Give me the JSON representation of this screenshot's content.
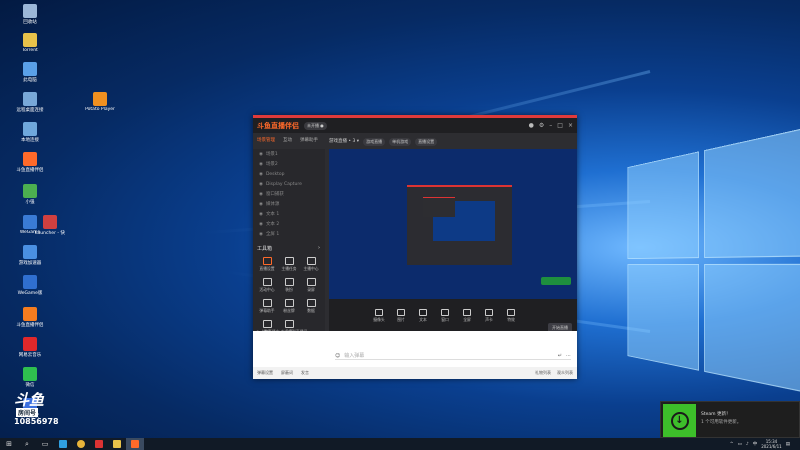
{
  "desktop": {
    "icons": [
      {
        "label": "回收站",
        "color": "#9bb7d8"
      },
      {
        "label": "Torrent",
        "color": "#e8c24a"
      },
      {
        "label": "此电脑",
        "color": "#5aa0e8"
      },
      {
        "label": "远程桌面连接",
        "color": "#78a8d8"
      },
      {
        "label": "本地连接",
        "color": "#6fa8dc"
      },
      {
        "label": "斗鱼直播伴侣",
        "color": "#ff6a2a"
      },
      {
        "label": "小强",
        "color": "#4caf50"
      },
      {
        "label": "WeGame",
        "color": "#3a7bd5"
      },
      {
        "label": "游戏加速器",
        "color": "#4a90e2"
      },
      {
        "label": "WeGame版",
        "color": "#2f6fd0"
      },
      {
        "label": "斗鱼直播伴侣",
        "color": "#f57c1f"
      },
      {
        "label": "网易云音乐",
        "color": "#e0282b"
      },
      {
        "label": "微信",
        "color": "#2fbf4f"
      },
      {
        "label": "腾讯会议",
        "color": "#3a6fe0"
      },
      {
        "label": "Potato Player",
        "color": "#f09020"
      },
      {
        "label": "Launcher - 快捷方式",
        "color": "#d04040"
      }
    ]
  },
  "app": {
    "brand": "斗鱼直播伴侣",
    "status": "未开播 ●",
    "tabs": [
      "场景管理",
      "互动",
      "弹幕助手"
    ],
    "stream_title": "游戏直播 • 3 ▾",
    "preview_tags": [
      "游戏直播",
      "单机游戏",
      "直播设置"
    ],
    "scenes": [
      "场景1",
      "场景2",
      "Desktop",
      "Display Capture",
      "窗口捕获",
      "媒体源",
      "文本 1",
      "文本 2",
      "全屏 1"
    ],
    "tools_title": "工具箱",
    "tools": [
      "直播设置",
      "主播任务",
      "主播中心",
      "活动中心",
      "装扮",
      "录屏",
      "弹幕助手",
      "粉丝牌",
      "数据",
      "特效",
      "分享"
    ],
    "stream_info": "● 人数直播中 欢迎来到直播间",
    "toolbar": [
      "摄像头",
      "图片",
      "文本",
      "窗口",
      "全屏",
      "声卡",
      "特效"
    ],
    "start_button": "开始直播"
  },
  "chat": {
    "input_hint": "输入弹幕",
    "footer_left": [
      "弹幕设置",
      "屏蔽词",
      "发言"
    ],
    "footer_right": [
      "礼物列表",
      "观众列表"
    ]
  },
  "toast": {
    "title": "Steam 更新！",
    "body": "1 个可用软件更新。"
  },
  "douyu": {
    "logo_text": "斗鱼",
    "room_label": "房间号",
    "room_number": "10856978"
  },
  "taskbar": {
    "time": "15:34",
    "date": "2021/6/11"
  }
}
